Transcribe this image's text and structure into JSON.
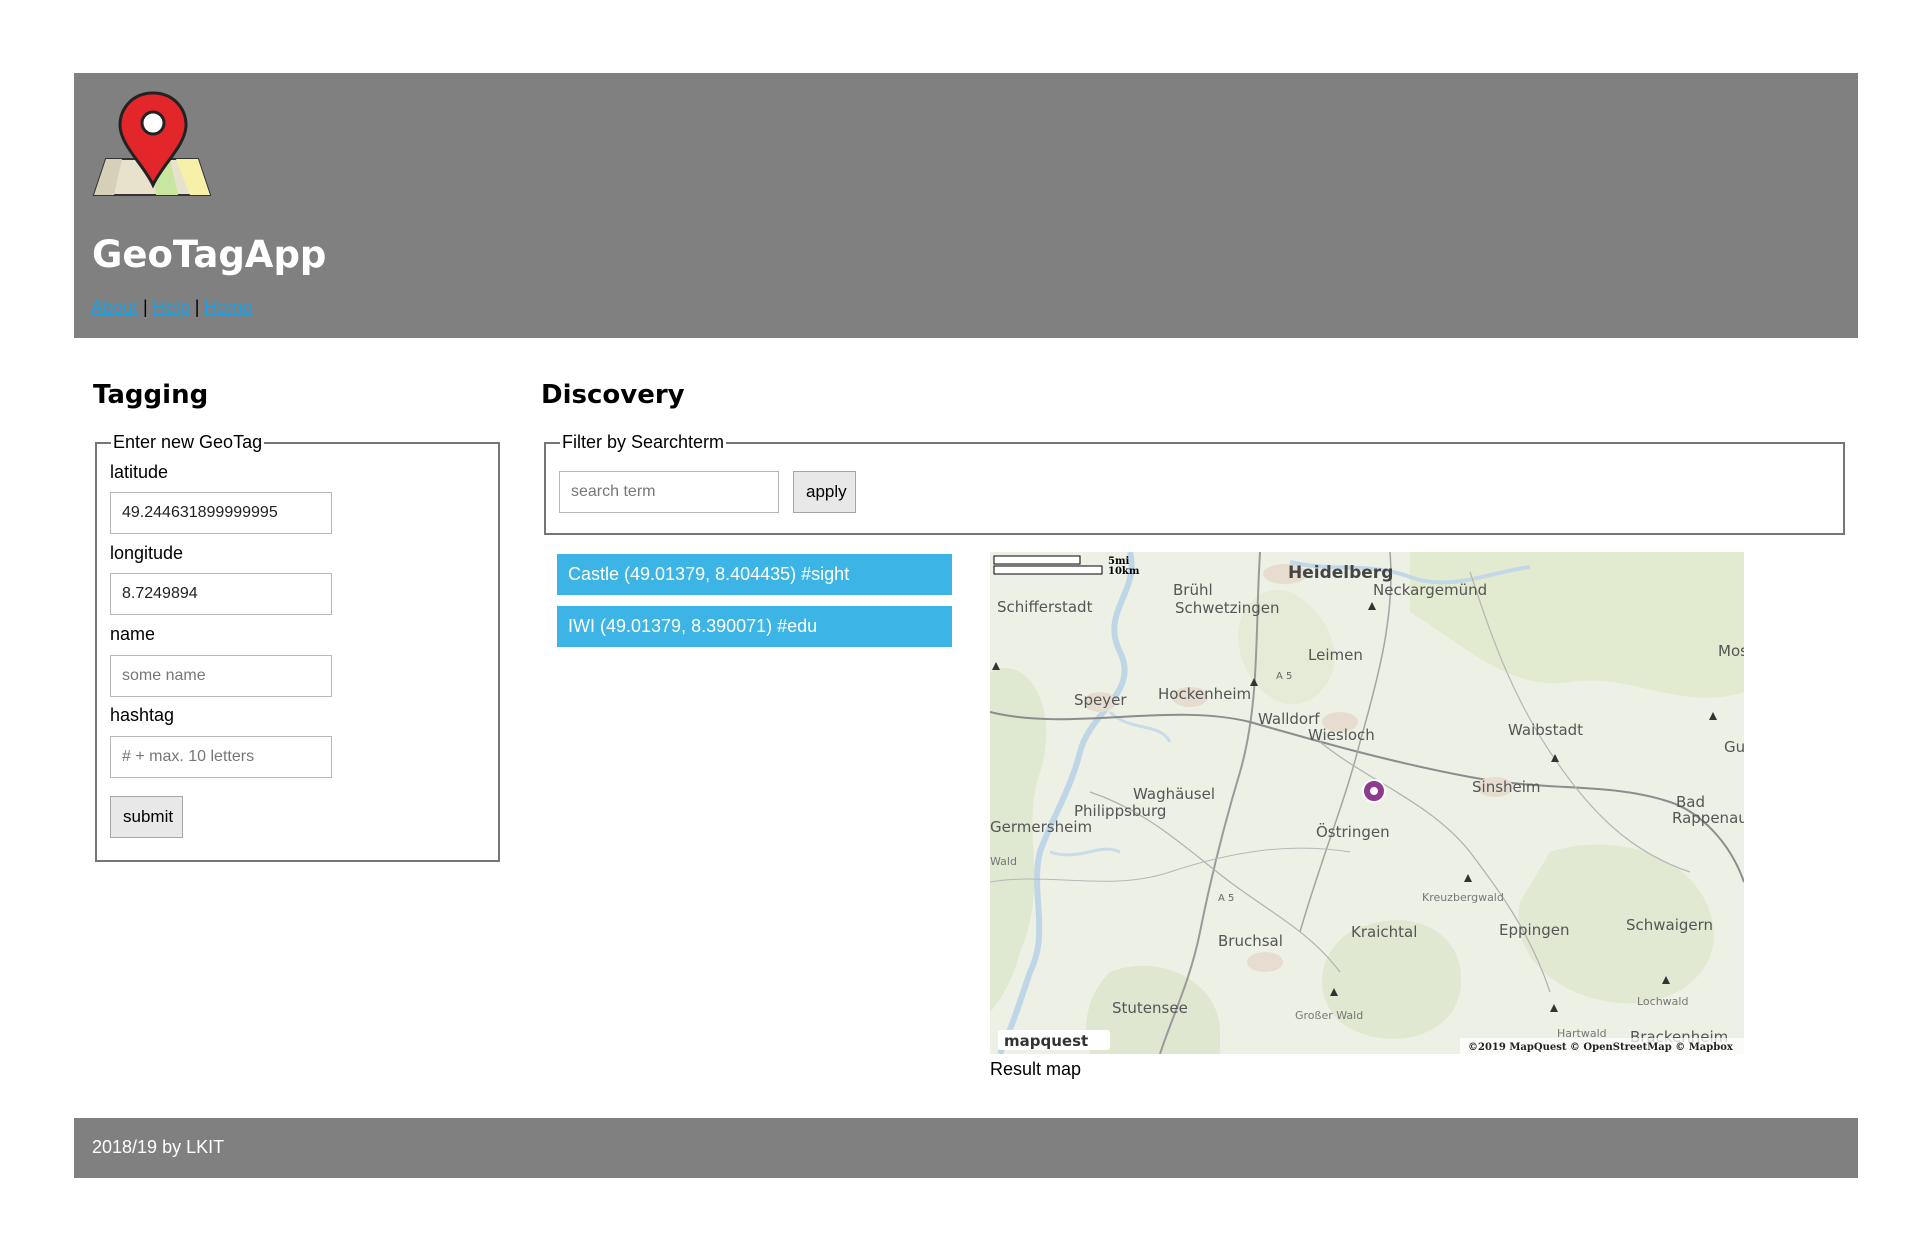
{
  "header": {
    "title": "GeoTagApp",
    "nav": [
      {
        "label": "About"
      },
      {
        "label": "Help"
      },
      {
        "label": "Home"
      }
    ],
    "nav_separator": "|"
  },
  "tagging": {
    "title": "Tagging",
    "legend": "Enter new GeoTag",
    "latitude_label": "latitude",
    "latitude_value": "49.244631899999995",
    "longitude_label": "longitude",
    "longitude_value": "8.7249894",
    "name_label": "name",
    "name_placeholder": "some name",
    "hashtag_label": "hashtag",
    "hashtag_placeholder": "# + max. 10 letters",
    "submit_label": "submit"
  },
  "discovery": {
    "title": "Discovery",
    "legend": "Filter by Searchterm",
    "search_placeholder": "search term",
    "apply_label": "apply",
    "results": [
      {
        "text": "Castle (49.01379, 8.404435) #sight"
      },
      {
        "text": "IWI (49.01379, 8.390071) #edu"
      }
    ]
  },
  "map": {
    "scale_mi": "5mi",
    "scale_km": "10km",
    "places": [
      {
        "name": "Heidelberg",
        "bold": true
      },
      {
        "name": "Neckargemünd"
      },
      {
        "name": "Schifferstadt"
      },
      {
        "name": "Brühl"
      },
      {
        "name": "Schwetzingen"
      },
      {
        "name": "Leimen"
      },
      {
        "name": "Mos"
      },
      {
        "name": "A 5"
      },
      {
        "name": "Hockenheim"
      },
      {
        "name": "Speyer"
      },
      {
        "name": "Walldorf"
      },
      {
        "name": "Wiesloch"
      },
      {
        "name": "Waibstadt"
      },
      {
        "name": "Gur"
      },
      {
        "name": "Sinsheim"
      },
      {
        "name": "Bad"
      },
      {
        "name": "Rappenau"
      },
      {
        "name": "Waghäusel"
      },
      {
        "name": "Philippsburg"
      },
      {
        "name": "Germersheim"
      },
      {
        "name": "Östringen"
      },
      {
        "name": "Kreuzbergwald"
      },
      {
        "name": "A 5"
      },
      {
        "name": "Eppingen"
      },
      {
        "name": "Schwaigern"
      },
      {
        "name": "Bruchsal"
      },
      {
        "name": "Kraichtal"
      },
      {
        "name": "Lochwald"
      },
      {
        "name": "Stutensee"
      },
      {
        "name": "Großer Wald"
      },
      {
        "name": "Hartwald"
      },
      {
        "name": "Brackenheim"
      },
      {
        "name": "Wald"
      }
    ],
    "brand": "mapquest",
    "attribution": "©2019 MapQuest © OpenStreetMap © Mapbox",
    "marker_color": "#8e3a8e",
    "caption": "Result map"
  },
  "footer": {
    "text": "2018/19 by LKIT"
  },
  "colors": {
    "header_bg": "#808080",
    "result_bg": "#3cb4e6",
    "link": "#1fa0e0"
  }
}
